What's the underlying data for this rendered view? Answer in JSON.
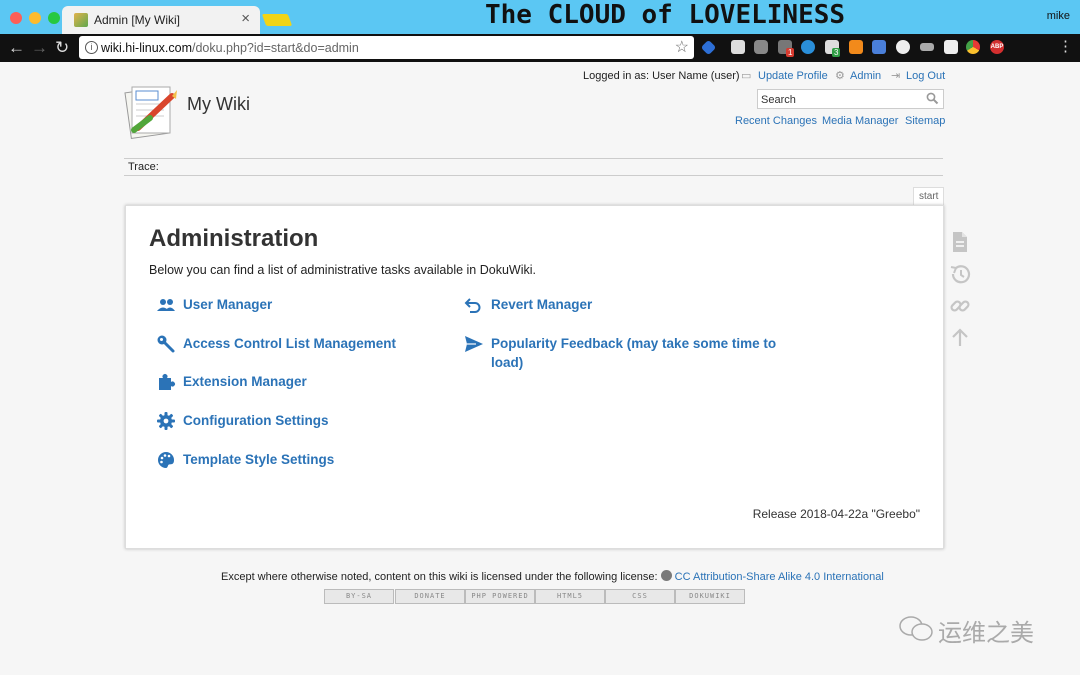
{
  "browser": {
    "tab_title": "Admin [My Wiki]",
    "tab_close": "×",
    "banner": "The CLOUD of LOVELINESS",
    "profile_name": "mike",
    "url_host": "wiki.hi-linux.com",
    "url_path": "/doku.php?id=start&do=admin",
    "star": "☆",
    "back": "←",
    "forward": "→",
    "reload": "↻",
    "ext_badges": [
      "1",
      "3"
    ],
    "adblock_label": "ABP"
  },
  "site": {
    "title": "My Wiki",
    "logged_in": "Logged in as: User Name (user)",
    "update_profile": "Update Profile",
    "admin": "Admin",
    "logout": "Log Out",
    "search_placeholder": "Search",
    "recent_changes": "Recent Changes",
    "media_manager": "Media Manager",
    "sitemap": "Sitemap",
    "trace": "Trace:",
    "page_tab": "start"
  },
  "admin": {
    "title": "Administration",
    "description": "Below you can find a list of administrative tasks available in DokuWiki.",
    "left_items": [
      {
        "label": "User Manager",
        "icon": "users-icon"
      },
      {
        "label": "Access Control List Management",
        "icon": "key-icon"
      },
      {
        "label": "Extension Manager",
        "icon": "puzzle-icon"
      },
      {
        "label": "Configuration Settings",
        "icon": "gear-icon"
      },
      {
        "label": "Template Style Settings",
        "icon": "palette-icon"
      }
    ],
    "right_items": [
      {
        "label": "Revert Manager",
        "icon": "revert-icon"
      },
      {
        "label": "Popularity Feedback (may take some time to",
        "label2": "load)",
        "icon": "send-icon"
      }
    ],
    "release": "Release 2018-04-22a \"Greebo\""
  },
  "sidebar_icons": [
    "page-icon",
    "history-icon",
    "link-icon",
    "arrow-up-icon"
  ],
  "footer": {
    "license_text": "Except where otherwise noted, content on this wiki is licensed under the following license:",
    "license_link": "CC Attribution-Share Alike 4.0 International",
    "badges": [
      "BY-SA",
      "DONATE",
      "PHP POWERED",
      "HTML5",
      "CSS",
      "DOKUWIKI"
    ]
  },
  "watermark": "运维之美",
  "colors": {
    "link": "#2b73b7",
    "tabbar": "#5bc7f3",
    "toolbar": "#111111"
  }
}
